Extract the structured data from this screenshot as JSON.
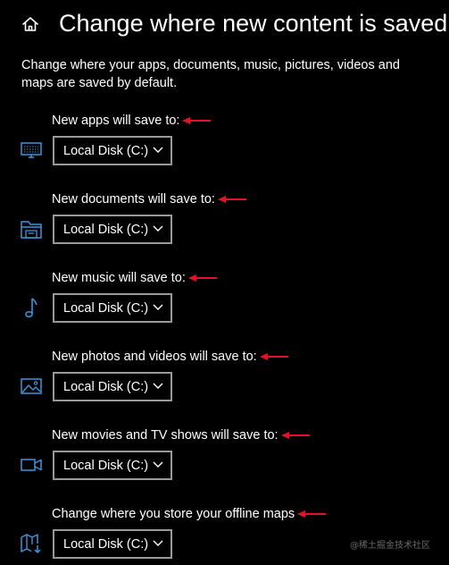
{
  "header": {
    "title": "Change where new content is saved",
    "home_icon": "home-icon"
  },
  "description": "Change where your apps, documents, music, pictures, videos and maps are saved by default.",
  "settings": [
    {
      "label": "New apps will save to:",
      "value": "Local Disk (C:)",
      "icon": "monitor-icon"
    },
    {
      "label": "New documents will save to:",
      "value": "Local Disk (C:)",
      "icon": "folder-icon"
    },
    {
      "label": "New music will save to:",
      "value": "Local Disk (C:)",
      "icon": "music-note-icon"
    },
    {
      "label": "New photos and videos will save to:",
      "value": "Local Disk (C:)",
      "icon": "image-icon"
    },
    {
      "label": "New movies and TV shows will save to:",
      "value": "Local Disk (C:)",
      "icon": "video-camera-icon"
    },
    {
      "label": "Change where you store your offline maps",
      "value": "Local Disk (C:)",
      "icon": "map-icon"
    }
  ],
  "watermark": "@稀土掘金技术社区",
  "colors": {
    "background": "#000000",
    "text": "#ffffff",
    "icon_accent": "#3a96dd",
    "annotation_arrow": "#e81123",
    "dropdown_border": "#9a9a9a"
  }
}
